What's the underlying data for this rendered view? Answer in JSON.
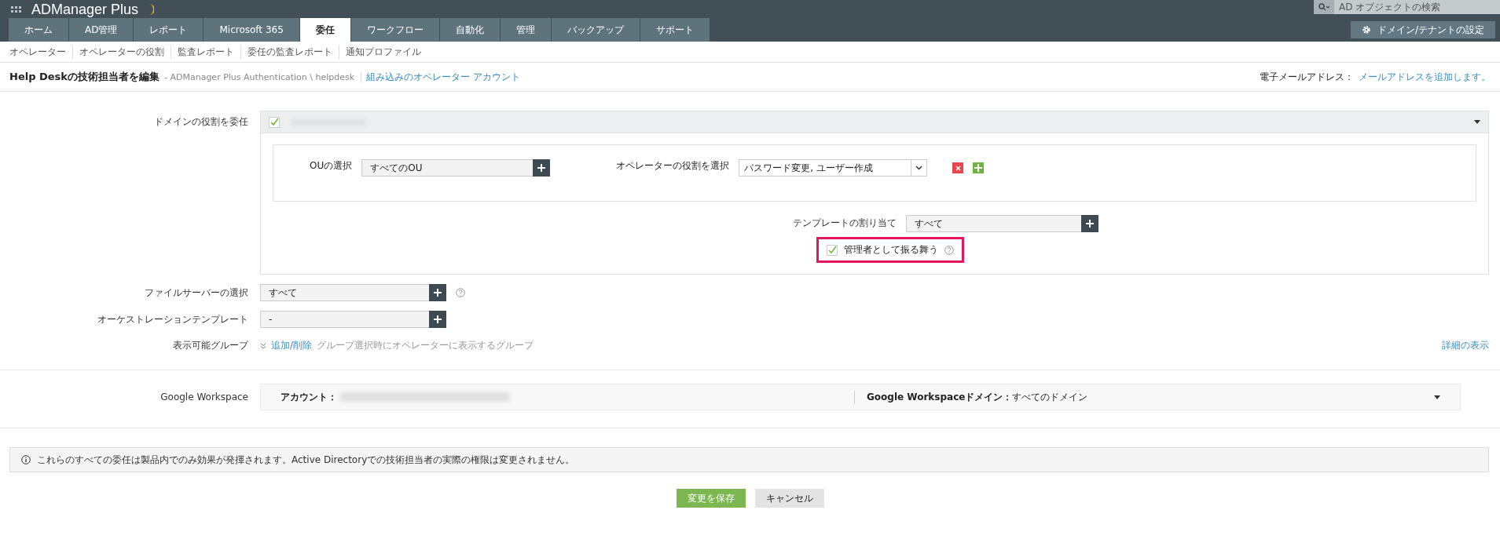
{
  "app": {
    "logo": "ADManager Plus",
    "search_placeholder": "AD オブジェクトの検索",
    "settings_button": "ドメイン/テナントの設定"
  },
  "tabs": [
    {
      "label": "ホーム",
      "selected": false
    },
    {
      "label": "AD管理",
      "selected": false
    },
    {
      "label": "レポート",
      "selected": false
    },
    {
      "label": "Microsoft 365",
      "selected": false
    },
    {
      "label": "委任",
      "selected": true
    },
    {
      "label": "ワークフロー",
      "selected": false
    },
    {
      "label": "自動化",
      "selected": false
    },
    {
      "label": "管理",
      "selected": false
    },
    {
      "label": "バックアップ",
      "selected": false
    },
    {
      "label": "サポート",
      "selected": false
    }
  ],
  "subnav": [
    "オペレーター",
    "オペレーターの役割",
    "監査レポート",
    "委任の監査レポート",
    "通知プロファイル"
  ],
  "header": {
    "title": "Help Deskの技術担当者を編集",
    "path": "- ADManager Plus Authentication \\ helpdesk",
    "link": "組み込みのオペレーター アカウント",
    "email_label": "電子メールアドレス：",
    "email_link": "メールアドレスを追加します。"
  },
  "domain_roles": {
    "label": "ドメインの役割を委任",
    "checked": true,
    "ou_label": "OUの選択",
    "ou_value": "すべてのOU",
    "role_label": "オペレーターの役割を選択",
    "role_value": "パスワード変更, ユーザー作成",
    "template_label": "テンプレートの割り当て",
    "template_value": "すべて",
    "act_as_admin": {
      "label": "管理者として振る舞う",
      "checked": true
    }
  },
  "file_server": {
    "label": "ファイルサーバーの選択",
    "value": "すべて"
  },
  "orchestration": {
    "label": "オーケストレーションテンプレート",
    "value": "-"
  },
  "visible_groups": {
    "label": "表示可能グループ",
    "link": "追加/削除",
    "hint": "グループ選択時にオペレーターに表示するグループ",
    "details_link": "詳細の表示"
  },
  "google_workspace": {
    "label": "Google Workspace",
    "account_label": "アカウント：",
    "domain_label": "Google Workspaceドメイン：",
    "domain_value": "すべてのドメイン"
  },
  "notice": "これらのすべての委任は製品内でのみ効果が発揮されます。Active Directoryでの技術担当者の実際の権限は変更されません。",
  "buttons": [
    {
      "label": "変更を保存",
      "kind": "primary"
    },
    {
      "label": "キャンセル",
      "kind": "secondary"
    }
  ]
}
